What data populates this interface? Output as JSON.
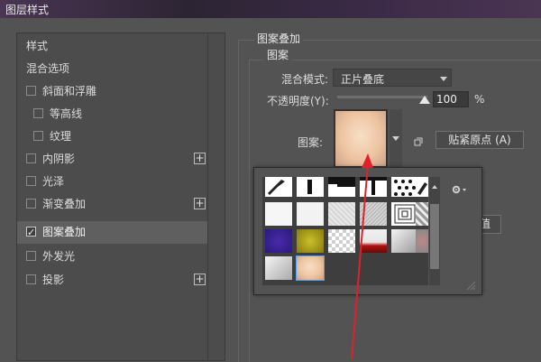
{
  "window": {
    "title": "图层样式"
  },
  "sidebar": {
    "header": "样式",
    "blend_options": "混合选项",
    "items": [
      {
        "label": "斜面和浮雕",
        "checked": false,
        "has_plus": false,
        "indent": 0
      },
      {
        "label": "等高线",
        "checked": false,
        "has_plus": false,
        "indent": 1
      },
      {
        "label": "纹理",
        "checked": false,
        "has_plus": false,
        "indent": 1
      },
      {
        "label": "内阴影",
        "checked": false,
        "has_plus": true,
        "indent": 0
      },
      {
        "label": "光泽",
        "checked": false,
        "has_plus": false,
        "indent": 0
      },
      {
        "label": "渐变叠加",
        "checked": false,
        "has_plus": true,
        "indent": 0
      },
      {
        "label": "图案叠加",
        "checked": true,
        "has_plus": false,
        "indent": 0,
        "selected": true
      },
      {
        "label": "外发光",
        "checked": false,
        "has_plus": false,
        "indent": 0
      },
      {
        "label": "投影",
        "checked": false,
        "has_plus": true,
        "indent": 0
      }
    ]
  },
  "panel": {
    "group_title": "图案叠加",
    "sub_title": "图案",
    "blend_mode_label": "混合模式:",
    "blend_mode_value": "正片叠底",
    "opacity_label": "不透明度(Y):",
    "opacity_value": "100",
    "opacity_unit": "%",
    "opacity_fraction": 1.0,
    "pattern_label": "图案:",
    "snap_button": "贴紧原点 (A)",
    "partial_button_text": "值"
  },
  "colors": {
    "accent_arrow": "#e0202a",
    "selected_bg": "#5f5f5f",
    "panel_bg": "#535353"
  }
}
